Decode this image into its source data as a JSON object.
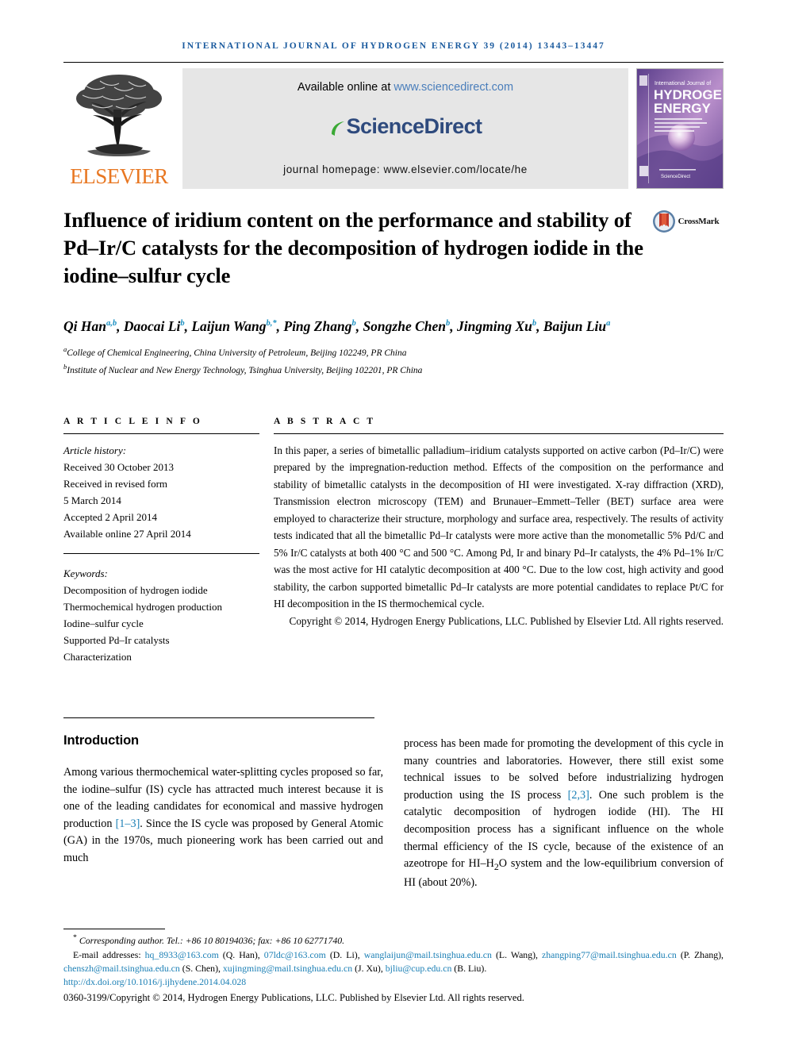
{
  "running_head": "INTERNATIONAL JOURNAL OF HYDROGEN ENERGY 39 (2014) 13443–13447",
  "masthead": {
    "publisher": "ELSEVIER",
    "available_prefix": "Available online at ",
    "available_url": "www.sciencedirect.com",
    "sciencedirect_sci": "Science",
    "sciencedirect_direct": "Direct",
    "homepage": "journal homepage: www.elsevier.com/locate/he",
    "cover_line1": "International Journal of",
    "cover_line2": "HYDROGEN",
    "cover_line3": "ENERGY",
    "cover_sd": "ScienceDirect"
  },
  "title": "Influence of iridium content on the performance and stability of Pd–Ir/C catalysts for the decomposition of hydrogen iodide in the iodine–sulfur cycle",
  "crossmark_label": "CrossMark",
  "authors": [
    {
      "name": "Qi Han",
      "marks": "a,b"
    },
    {
      "name": "Daocai Li",
      "marks": "b"
    },
    {
      "name": "Laijun Wang",
      "marks": "b,*"
    },
    {
      "name": "Ping Zhang",
      "marks": "b"
    },
    {
      "name": "Songzhe Chen",
      "marks": "b"
    },
    {
      "name": "Jingming Xu",
      "marks": "b"
    },
    {
      "name": "Baijun Liu",
      "marks": "a"
    }
  ],
  "affiliations": [
    {
      "mark": "a",
      "text": "College of Chemical Engineering, China University of Petroleum, Beijing 102249, PR China"
    },
    {
      "mark": "b",
      "text": "Institute of Nuclear and New Energy Technology, Tsinghua University, Beijing 102201, PR China"
    }
  ],
  "article_info": {
    "heading": "A R T I C L E   I N F O",
    "history_label": "Article history:",
    "history": [
      "Received 30 October 2013",
      "Received in revised form",
      "5 March 2014",
      "Accepted 2 April 2014",
      "Available online 27 April 2014"
    ],
    "keywords_label": "Keywords:",
    "keywords": [
      "Decomposition of hydrogen iodide",
      "Thermochemical hydrogen production",
      "Iodine–sulfur cycle",
      "Supported Pd–Ir catalysts",
      "Characterization"
    ]
  },
  "abstract": {
    "heading": "A B S T R A C T",
    "text": "In this paper, a series of bimetallic palladium–iridium catalysts supported on active carbon (Pd–Ir/C) were prepared by the impregnation-reduction method. Effects of the composition on the performance and stability of bimetallic catalysts in the decomposition of HI were investigated. X-ray diffraction (XRD), Transmission electron microscopy (TEM) and Brunauer–Emmett–Teller (BET) surface area were employed to characterize their structure, morphology and surface area, respectively. The results of activity tests indicated that all the bimetallic Pd–Ir catalysts were more active than the monometallic 5% Pd/C and 5% Ir/C catalysts at both 400 °C and 500 °C. Among Pd, Ir and binary Pd–Ir catalysts, the 4% Pd–1% Ir/C was the most active for HI catalytic decomposition at 400 °C. Due to the low cost, high activity and good stability, the carbon supported bimetallic Pd–Ir catalysts are more potential candidates to replace Pt/C for HI decomposition in the IS thermochemical cycle.",
    "copyright": "Copyright © 2014, Hydrogen Energy Publications, LLC. Published by Elsevier Ltd. All rights reserved."
  },
  "introduction": {
    "title": "Introduction",
    "left_part1": "Among various thermochemical water-splitting cycles proposed so far, the iodine–sulfur (IS) cycle has attracted much interest because it is one of the leading candidates for economical and massive hydrogen production ",
    "left_cite": "[1–3]",
    "left_part2": ". Since the IS cycle was proposed by General Atomic (GA) in the 1970s, much pioneering work has been carried out and much",
    "right_part1": "process has been made for promoting the development of this cycle in many countries and laboratories. However, there still exist some technical issues to be solved before industrializing hydrogen production using the IS process ",
    "right_cite": "[2,3]",
    "right_part2": ". One such problem is the catalytic decomposition of hydrogen iodide (HI). The HI decomposition process has a significant influence on the whole thermal efficiency of the IS cycle, because of the existence of an azeotrope for HI–H",
    "right_sub": "2",
    "right_part3": "O system and the low-equilibrium conversion of HI (about 20%)."
  },
  "footnotes": {
    "corresponding": "Corresponding author. Tel.: +86 10 80194036; fax: +86 10 62771740.",
    "emails_label": "E-mail addresses: ",
    "emails": [
      {
        "mail": "hq_8933@163.com",
        "who": " (Q. Han), "
      },
      {
        "mail": "07ldc@163.com",
        "who": " (D. Li), "
      },
      {
        "mail": "wanglaijun@mail.tsinghua.edu.cn",
        "who": " (L. Wang), "
      },
      {
        "mail": "zhangping77@mail.tsinghua.edu.cn",
        "who": " (P. Zhang), "
      },
      {
        "mail": "chenszh@mail.tsinghua.edu.cn",
        "who": " (S. Chen), "
      },
      {
        "mail": "xujingming@mail.tsinghua.edu.cn",
        "who": " (J. Xu), "
      },
      {
        "mail": "bjliu@cup.edu.cn",
        "who": " (B. Liu)."
      }
    ],
    "doi": "http://dx.doi.org/10.1016/j.ijhydene.2014.04.028",
    "issn": "0360-3199/Copyright © 2014, Hydrogen Energy Publications, LLC. Published by Elsevier Ltd. All rights reserved."
  },
  "colors": {
    "journal_blue": "#1a5a9e",
    "link_blue": "#1a7fb5",
    "elsevier_orange": "#E87722",
    "sciencedirect_green": "#3aa935",
    "banner_gray": "#e6e6e6"
  }
}
